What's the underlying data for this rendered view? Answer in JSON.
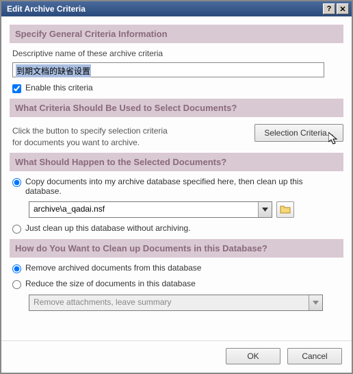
{
  "window": {
    "title": "Edit Archive Criteria"
  },
  "sections": {
    "general": {
      "header": "Specify General Criteria Information",
      "name_label": "Descriptive name of these archive criteria",
      "name_value": "到期文档的缺省设置",
      "enable_label": "Enable this criteria"
    },
    "criteria": {
      "header": "What Criteria Should Be Used to Select Documents?",
      "hint_line1": "Click the button to specify selection criteria",
      "hint_line2": "for documents you want to archive.",
      "button": "Selection Criteria..."
    },
    "action": {
      "header": "What Should Happen to the Selected Documents?",
      "copy_label": "Copy documents into my archive database specified here, then clean up this database.",
      "archive_db": "archive\\a_qadai.nsf",
      "just_clean_label": "Just clean up this database without archiving."
    },
    "cleanup": {
      "header": "How do You Want to Clean up Documents in this Database?",
      "remove_label": "Remove archived documents from this database",
      "reduce_label": "Reduce the size of documents in this database",
      "reduce_option": "Remove attachments, leave summary"
    }
  },
  "buttons": {
    "ok": "OK",
    "cancel": "Cancel"
  }
}
